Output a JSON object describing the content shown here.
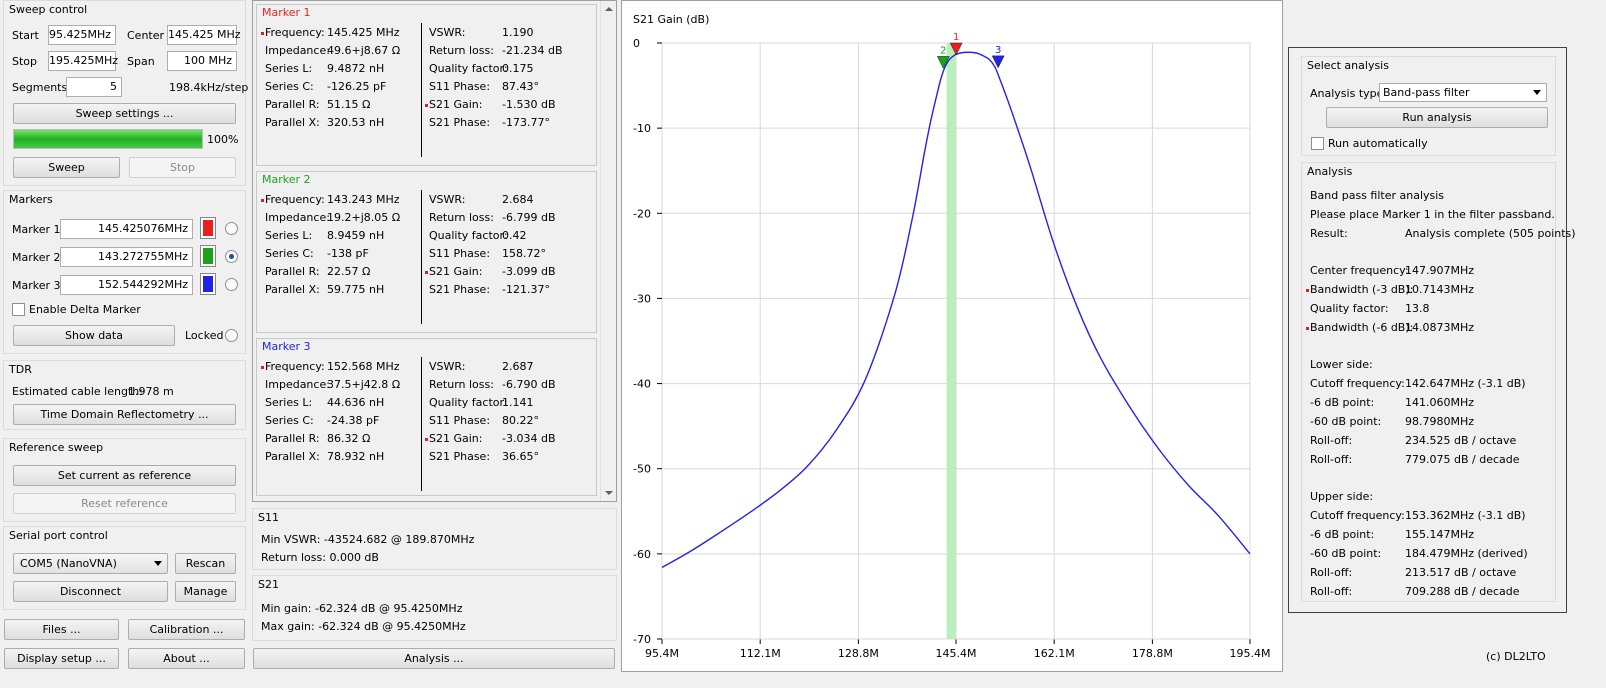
{
  "sweep_control": {
    "title": "Sweep control",
    "start_label": "Start",
    "start_value": "95.425MHz",
    "center_label": "Center",
    "center_value": "145.425 MHz",
    "stop_label": "Stop",
    "stop_value": "195.425MHz",
    "span_label": "Span",
    "span_value": "100 MHz",
    "segments_label": "Segments",
    "segments_value": "5",
    "step_text": "198.4kHz/step",
    "settings_button": "Sweep settings ...",
    "progress_percent": 100,
    "progress_text": "100%",
    "sweep_button": "Sweep",
    "stop_button": "Stop"
  },
  "markers": {
    "title": "Markers",
    "items": [
      {
        "label": "Marker 1",
        "value": "145.425076MHz",
        "color": "#e8211f",
        "selected": false
      },
      {
        "label": "Marker 2",
        "value": "143.272755MHz",
        "color": "#1aa31a",
        "selected": true
      },
      {
        "label": "Marker 3",
        "value": "152.544292MHz",
        "color": "#2323e6",
        "selected": false
      }
    ],
    "delta_label": "Enable Delta Marker",
    "show_data_button": "Show data",
    "locked_label": "Locked"
  },
  "tdr": {
    "title": "TDR",
    "cable_label": "Estimated cable length:",
    "cable_value": "1.978 m",
    "button": "Time Domain Reflectometry ..."
  },
  "reference_sweep": {
    "title": "Reference sweep",
    "set_button": "Set current as reference",
    "reset_button": "Reset reference"
  },
  "serial": {
    "title": "Serial port control",
    "port_value": "COM5 (NanoVNA)",
    "rescan_button": "Rescan",
    "disconnect_button": "Disconnect",
    "manage_button": "Manage"
  },
  "bottom_buttons": {
    "files": "Files ...",
    "calibration": "Calibration ...",
    "display_setup": "Display setup ...",
    "about": "About ...",
    "analysis": "Analysis ..."
  },
  "marker_data": [
    {
      "title": "Marker 1",
      "title_color": "#e8211f",
      "left": [
        [
          "Frequency:",
          "145.425 MHz"
        ],
        [
          "Impedance:",
          "49.6+j8.67 Ω"
        ],
        [
          "Series L:",
          "9.4872 nH"
        ],
        [
          "Series C:",
          "-126.25 pF"
        ],
        [
          "Parallel R:",
          "51.15 Ω"
        ],
        [
          "Parallel X:",
          "320.53 nH"
        ]
      ],
      "right": [
        [
          "VSWR:",
          "1.190"
        ],
        [
          "Return loss:",
          "-21.234 dB"
        ],
        [
          "Quality factor:",
          "0.175"
        ],
        [
          "S11 Phase:",
          "87.43°"
        ],
        [
          "S21 Gain:",
          "-1.530 dB"
        ],
        [
          "S21 Phase:",
          "-173.77°"
        ]
      ]
    },
    {
      "title": "Marker 2",
      "title_color": "#1aa31a",
      "left": [
        [
          "Frequency:",
          "143.243 MHz"
        ],
        [
          "Impedance:",
          "19.2+j8.05 Ω"
        ],
        [
          "Series L:",
          "8.9459 nH"
        ],
        [
          "Series C:",
          "-138 pF"
        ],
        [
          "Parallel R:",
          "22.57 Ω"
        ],
        [
          "Parallel X:",
          "59.775 nH"
        ]
      ],
      "right": [
        [
          "VSWR:",
          "2.684"
        ],
        [
          "Return loss:",
          "-6.799 dB"
        ],
        [
          "Quality factor:",
          "0.42"
        ],
        [
          "S11 Phase:",
          "158.72°"
        ],
        [
          "S21 Gain:",
          "-3.099 dB"
        ],
        [
          "S21 Phase:",
          "-121.37°"
        ]
      ]
    },
    {
      "title": "Marker 3",
      "title_color": "#2323e6",
      "left": [
        [
          "Frequency:",
          "152.568 MHz"
        ],
        [
          "Impedance:",
          "37.5+j42.8 Ω"
        ],
        [
          "Series L:",
          "44.636 nH"
        ],
        [
          "Series C:",
          "-24.38 pF"
        ],
        [
          "Parallel R:",
          "86.32 Ω"
        ],
        [
          "Parallel X:",
          "78.932 nH"
        ]
      ],
      "right": [
        [
          "VSWR:",
          "2.687"
        ],
        [
          "Return loss:",
          "-6.790 dB"
        ],
        [
          "Quality factor:",
          "1.141"
        ],
        [
          "S11 Phase:",
          "80.22°"
        ],
        [
          "S21 Gain:",
          "-3.034 dB"
        ],
        [
          "S21 Phase:",
          "36.65°"
        ]
      ]
    }
  ],
  "s11": {
    "title": "S11",
    "min_vswr": "Min VSWR:  -43524.682 @ 189.870MHz",
    "return_loss": "Return loss: 0.000 dB"
  },
  "s21": {
    "title": "S21",
    "min_gain": "Min gain:  -62.324 dB @ 95.4250MHz",
    "max_gain": "Max gain:  -62.324 dB @ 95.4250MHz"
  },
  "analysis_panel": {
    "select_title": "Select analysis",
    "type_label": "Analysis type",
    "type_value": "Band-pass filter",
    "run_button": "Run analysis",
    "auto_label": "Run automatically",
    "analysis_title": "Analysis",
    "heading": "Band pass filter analysis",
    "instruction": "Please place Marker 1 in the filter passband.",
    "result_label": "Result:",
    "result_value": "Analysis complete (505 points)",
    "rows": [
      {
        "label": "Center frequency:",
        "value": "147.907MHz",
        "flag": false
      },
      {
        "label": "Bandwidth (-3 dB):",
        "value": "10.7143MHz",
        "flag": true
      },
      {
        "label": "Quality factor:",
        "value": "13.8",
        "flag": false
      },
      {
        "label": "Bandwidth (-6 dB):",
        "value": "14.0873MHz",
        "flag": true
      }
    ],
    "lower_title": "Lower side:",
    "lower_rows": [
      {
        "label": "Cutoff frequency:",
        "value": "142.647MHz (-3.1 dB)"
      },
      {
        "label": "-6 dB point:",
        "value": "141.060MHz"
      },
      {
        "label": "-60 dB point:",
        "value": "98.7980MHz"
      },
      {
        "label": "Roll-off:",
        "value": "234.525 dB / octave"
      },
      {
        "label": "Roll-off:",
        "value": "779.075 dB / decade"
      }
    ],
    "upper_title": "Upper side:",
    "upper_rows": [
      {
        "label": "Cutoff frequency:",
        "value": "153.362MHz (-3.1 dB)"
      },
      {
        "label": "-6 dB point:",
        "value": "155.147MHz"
      },
      {
        "label": "-60 dB point:",
        "value": "184.479MHz (derived)"
      },
      {
        "label": "Roll-off:",
        "value": "213.517 dB / octave"
      },
      {
        "label": "Roll-off:",
        "value": "709.288 dB / decade"
      }
    ]
  },
  "copyright": "(c) DL2LTO",
  "chart_data": {
    "type": "line",
    "title": "S21 Gain (dB)",
    "x_tick_labels": [
      "95.4M",
      "112.1M",
      "128.8M",
      "145.4M",
      "162.1M",
      "178.8M",
      "195.4M"
    ],
    "x_ticks": [
      95.4,
      112.1,
      128.8,
      145.4,
      162.1,
      178.8,
      195.4
    ],
    "y_tick_labels": [
      "0",
      "-10",
      "-20",
      "-30",
      "-40",
      "-50",
      "-60",
      "-70"
    ],
    "y_ticks": [
      0,
      -10,
      -20,
      -30,
      -40,
      -50,
      -60,
      -70
    ],
    "xlim": [
      95.4,
      195.4
    ],
    "ylim": [
      -70,
      0
    ],
    "grid": true,
    "line_color": "#2323e6",
    "band_color": "#b9f0b9",
    "band": [
      143.8,
      145.4
    ],
    "series": [
      {
        "x": [
          95.4,
          100,
          105,
          110,
          115,
          120,
          125,
          130,
          135,
          138,
          140,
          141,
          142,
          143,
          144,
          145,
          146,
          147,
          148,
          149,
          150,
          151,
          152,
          153,
          155,
          158,
          162,
          166,
          170,
          175,
          180,
          185,
          190,
          195.4
        ],
        "y": [
          -61.6,
          -59.8,
          -57.6,
          -55.3,
          -52.8,
          -49.8,
          -45.5,
          -39.5,
          -29.5,
          -20.5,
          -13,
          -9.5,
          -6.5,
          -3.8,
          -2.2,
          -1.5,
          -1.2,
          -1.1,
          -1.1,
          -1.2,
          -1.5,
          -1.9,
          -2.8,
          -4.5,
          -8.3,
          -14.5,
          -23.5,
          -31,
          -37,
          -42.8,
          -47.8,
          -52,
          -55.5,
          -60
        ]
      }
    ],
    "markers": [
      {
        "label": "1",
        "x": 145.425,
        "y": -1.53,
        "color": "#e8211f"
      },
      {
        "label": "2",
        "x": 143.243,
        "y": -3.099,
        "color": "#1aa31a"
      },
      {
        "label": "3",
        "x": 152.568,
        "y": -3.034,
        "color": "#2323e6"
      }
    ]
  }
}
